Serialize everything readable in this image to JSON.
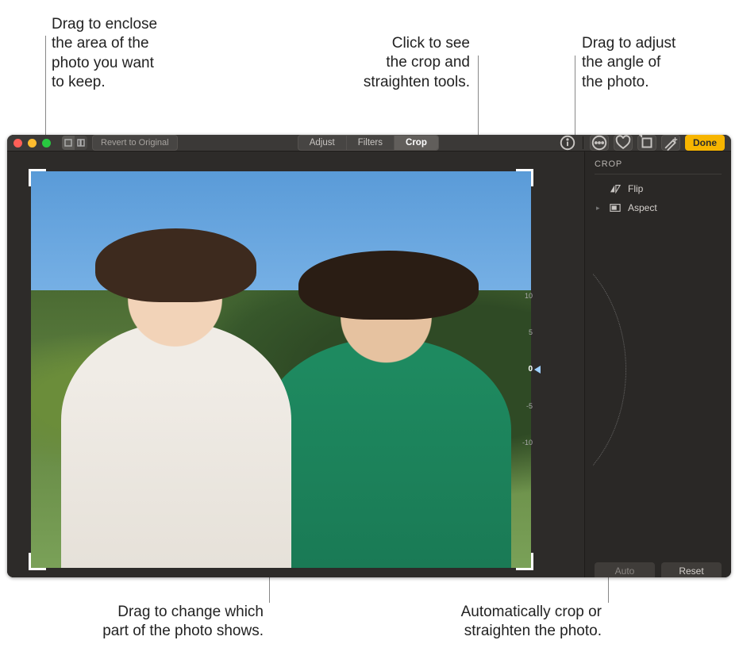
{
  "callouts": {
    "crop_handle": "Drag to enclose\nthe area of the\nphoto you want\nto keep.",
    "crop_tab": "Click to see\nthe crop and\nstraighten tools.",
    "angle_dial": "Drag to adjust\nthe angle of\nthe photo.",
    "drag_photo": "Drag to change which\npart of the photo shows.",
    "auto_button": "Automatically crop or\nstraighten the photo."
  },
  "toolbar": {
    "revert_label": "Revert to Original",
    "tabs": {
      "adjust": "Adjust",
      "filters": "Filters",
      "crop": "Crop"
    },
    "done_label": "Done"
  },
  "sidebar": {
    "title": "CROP",
    "flip_label": "Flip",
    "aspect_label": "Aspect",
    "auto_label": "Auto",
    "reset_label": "Reset"
  },
  "dial": {
    "labels": [
      "10",
      "5",
      "0",
      "-5",
      "-10"
    ],
    "value": "0"
  }
}
